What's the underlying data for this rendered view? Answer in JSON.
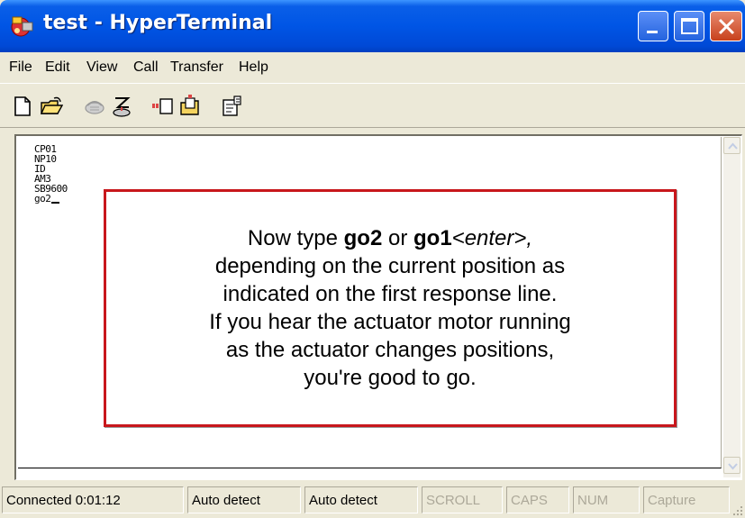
{
  "window": {
    "title": "test - HyperTerminal"
  },
  "menu": {
    "items": [
      "File",
      "Edit",
      "View",
      "Call",
      "Transfer",
      "Help"
    ]
  },
  "toolbar": {
    "buttons": [
      "new-icon",
      "open-icon",
      "call-icon",
      "disconnect-icon",
      "send-icon",
      "receive-icon",
      "properties-icon"
    ]
  },
  "terminal": {
    "lines": [
      "CP01",
      "NP10",
      "ID",
      "AM3",
      "SB9600",
      "go2"
    ]
  },
  "callout": {
    "line1_prefix": "Now type ",
    "line1_cmd1": "go2",
    "line1_or": " or ",
    "line1_cmd2": "go1",
    "line1_enter": "<enter>,",
    "line2": "depending on the current position as",
    "line3": "indicated on the first response line.",
    "line4": "If you hear the actuator motor running",
    "line5": "as the actuator changes positions,",
    "line6": "you're good to go.",
    "border_color": "#c8171c"
  },
  "status": {
    "connected": "Connected 0:01:12",
    "detect1": "Auto detect",
    "detect2": "Auto detect",
    "scroll": "SCROLL",
    "caps": "CAPS",
    "num": "NUM",
    "capture": "Capture"
  },
  "colors": {
    "titlebar": "#0055e5",
    "chrome": "#ece9d8"
  }
}
